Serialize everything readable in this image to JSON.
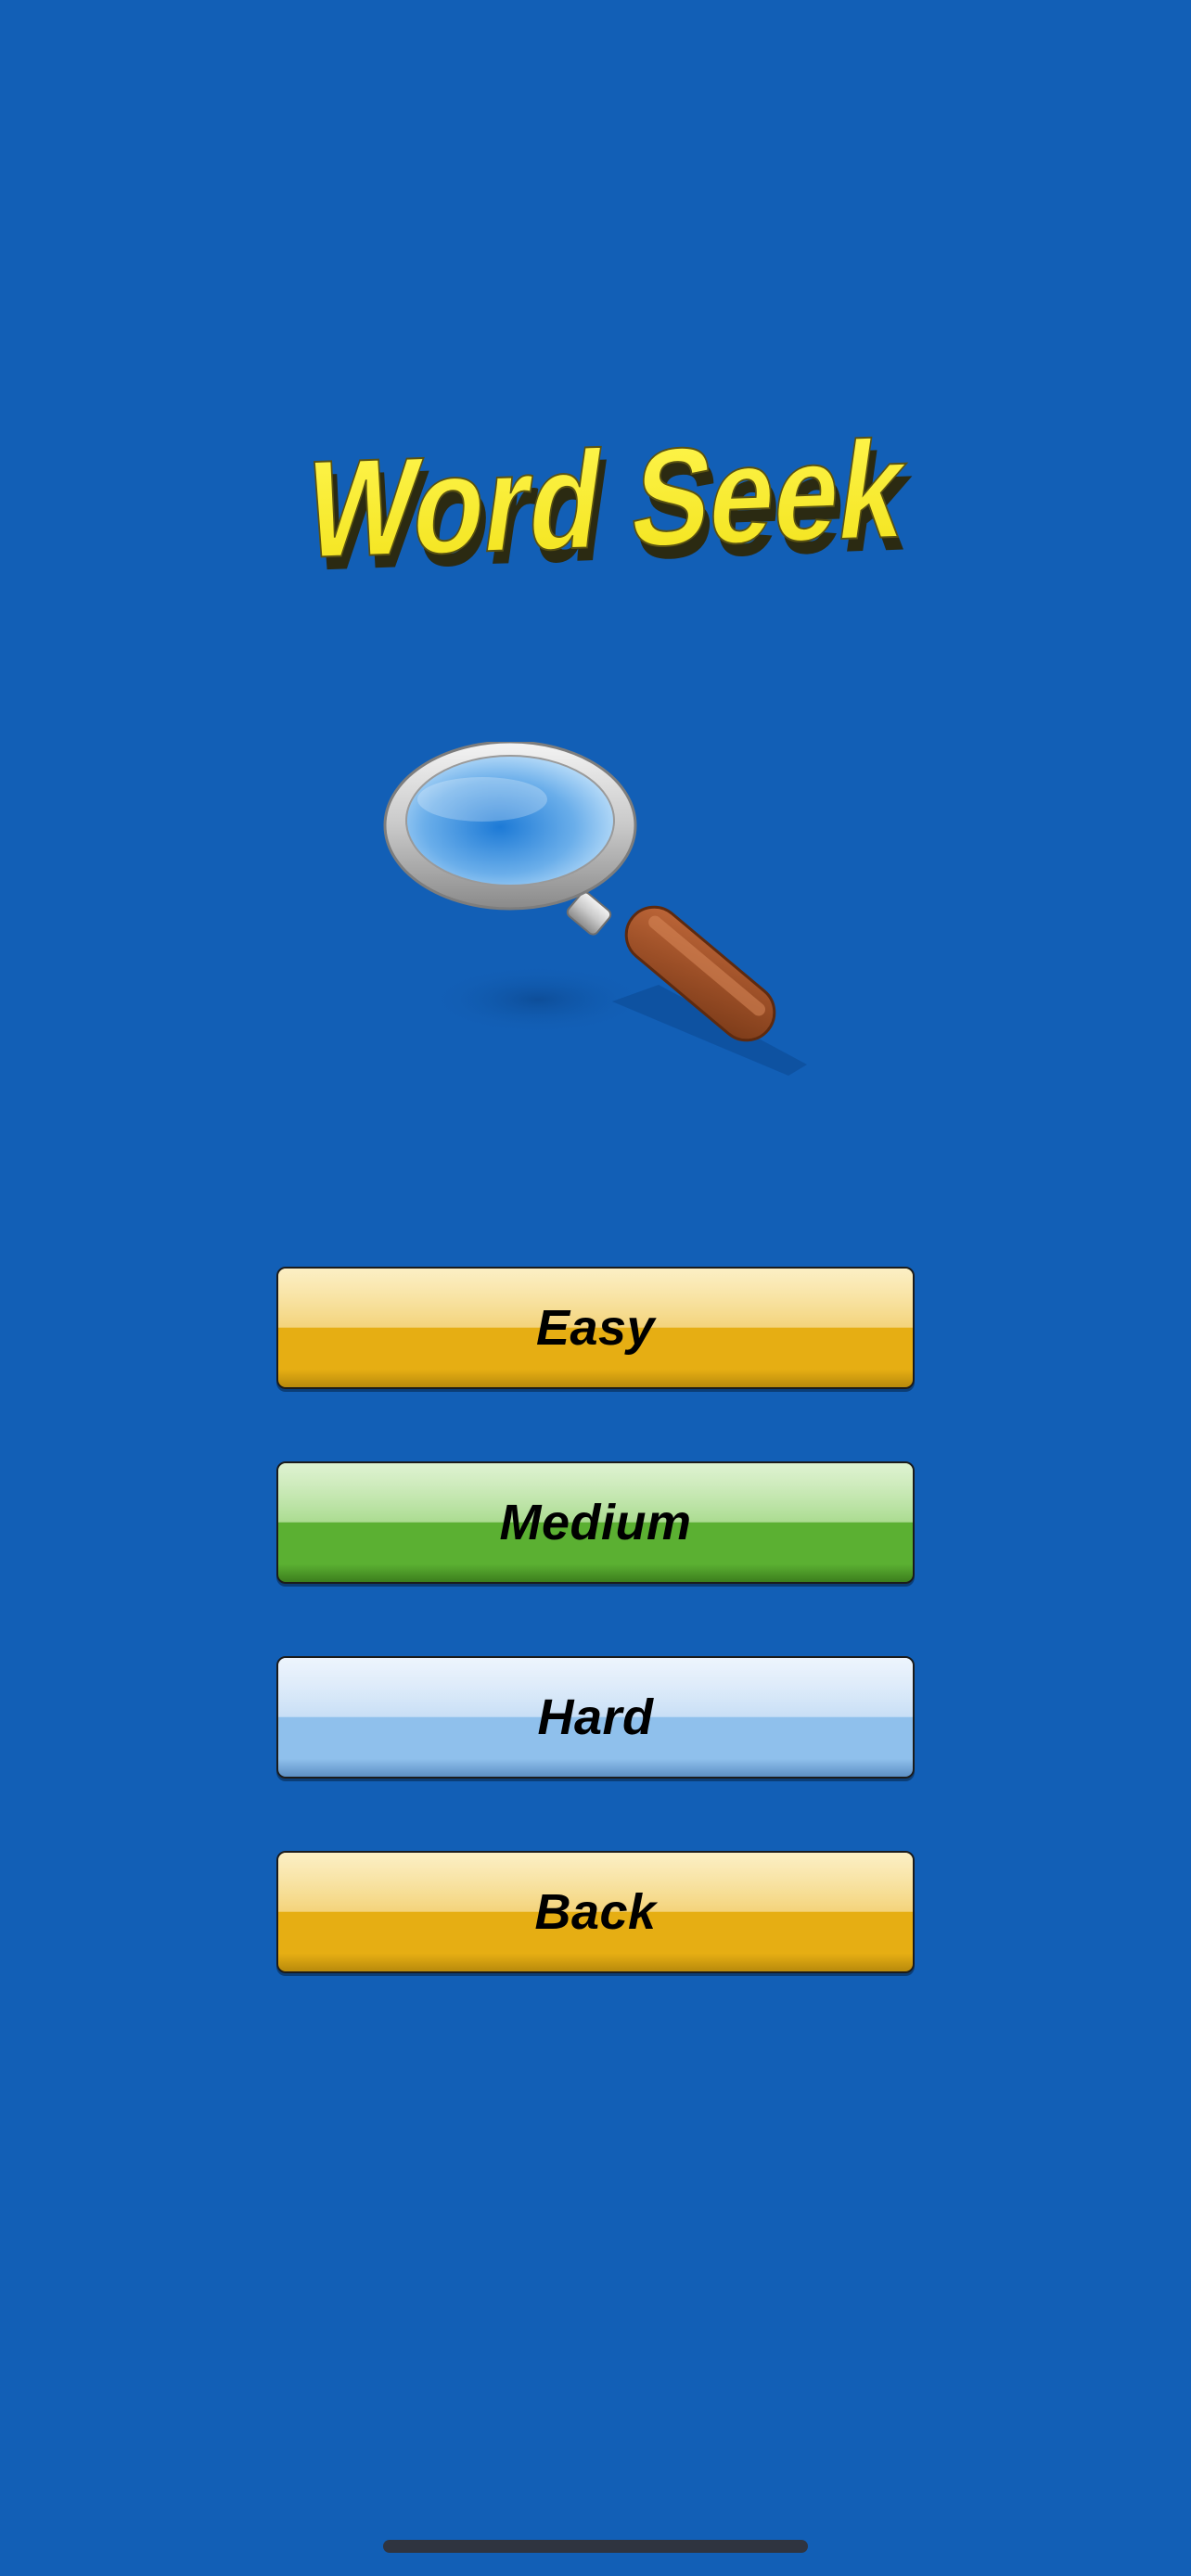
{
  "app": {
    "title": "Word Seek",
    "background_color": "#125fb6",
    "title_color": "#f5ec2a"
  },
  "menu": {
    "buttons": [
      {
        "id": "easy",
        "label": "Easy",
        "color": "#e6ae13"
      },
      {
        "id": "medium",
        "label": "Medium",
        "color": "#5bb032"
      },
      {
        "id": "hard",
        "label": "Hard",
        "color": "#8fc0ec"
      },
      {
        "id": "back",
        "label": "Back",
        "color": "#e6ae13"
      }
    ]
  },
  "icons": {
    "logo_art": "magnifying-glass-icon",
    "home_indicator": "home-indicator-bar"
  }
}
